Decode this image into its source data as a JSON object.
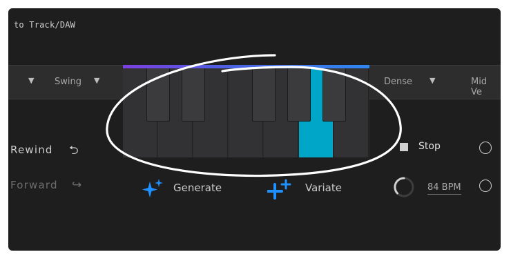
{
  "header": {
    "export_text": "to Track/DAW"
  },
  "toolbar": {
    "swing_label": "Swing",
    "density_label": "Dense",
    "velocity_label": "Mid Ve"
  },
  "keyboard": {
    "white_keys": 7,
    "active_key": "A",
    "accent_colors": [
      "#7b3fe0",
      "#2f86f0"
    ],
    "active_color": "#00a6c7"
  },
  "transport": {
    "rewind_label": "Rewind",
    "forward_label": "Forward",
    "rewind_icon": "undo-arrow-icon",
    "forward_icon": "hook-arrow-right-icon"
  },
  "actions": {
    "generate_label": "Generate",
    "variate_label": "Variate",
    "generate_icon": "sparkles-icon",
    "variate_icon": "plus-sparkles-icon"
  },
  "playback": {
    "stop_label": "Stop",
    "bpm_label": "84 BPM"
  }
}
